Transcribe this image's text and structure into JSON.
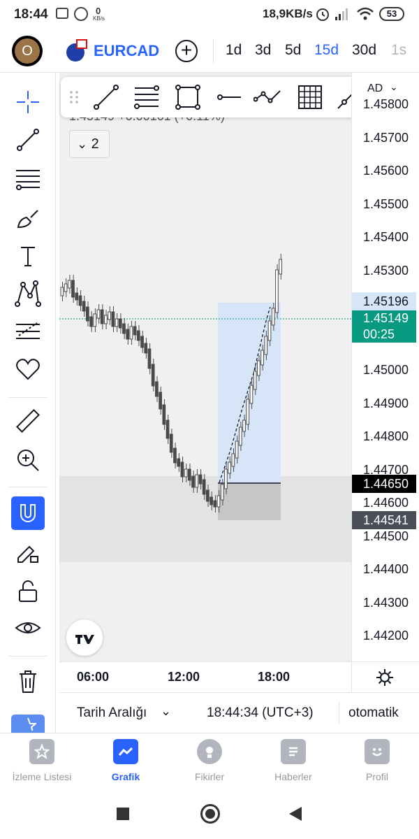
{
  "status_bar": {
    "time": "18:44",
    "net_speed": "0",
    "net_unit": "KB/s",
    "right": "18,9KB/s",
    "battery": "53"
  },
  "header": {
    "avatar_letter": "O",
    "symbol": "EURCAD",
    "timeframes": [
      "1d",
      "3d",
      "5d",
      "15d",
      "30d",
      "1s"
    ],
    "active_timeframe": "15d"
  },
  "chart": {
    "legend_text": "1.45149 +0.00161 (+0.11%)",
    "indicator_count": "2",
    "currency_tag": "AD",
    "price_labels": [
      "1.45800",
      "1.45700",
      "1.45600",
      "1.45500",
      "1.45400",
      "1.45300",
      "1.45000",
      "1.44900",
      "1.44800",
      "1.44700",
      "1.44600",
      "1.44500",
      "1.44400",
      "1.44300",
      "1.44200"
    ],
    "tag_upper": "1.45196",
    "tag_last": "1.45149",
    "tag_countdown": "00:25",
    "tag_crosshair": "1.44650",
    "tag_lower": "1.44541",
    "time_labels": [
      "06:00",
      "12:00",
      "18:00"
    ],
    "colors": {
      "last_price": "#089981",
      "selection": "#2962ff",
      "candle": "#4a4a4a"
    }
  },
  "footer": {
    "date_range": "Tarih Aralığı",
    "clock": "18:44:34 (UTC+3)",
    "scale_mode": "otomatik"
  },
  "left_toolbar": [
    "crosshair-icon",
    "trendline-icon",
    "fib-icon",
    "brush-icon",
    "text-icon",
    "pattern-icon",
    "prediction-icon",
    "heart-icon",
    "ruler-icon",
    "zoom-in-icon",
    "magnet-icon",
    "lock-drawing-icon",
    "unlock-icon",
    "eye-icon",
    "trash-icon"
  ],
  "bottom_nav": [
    {
      "label": "İzleme Listesi",
      "icon": "star-icon"
    },
    {
      "label": "Grafik",
      "icon": "chart-icon"
    },
    {
      "label": "Fikirler",
      "icon": "bulb-icon"
    },
    {
      "label": "Haberler",
      "icon": "news-icon"
    },
    {
      "label": "Profil",
      "icon": "smile-icon"
    }
  ]
}
